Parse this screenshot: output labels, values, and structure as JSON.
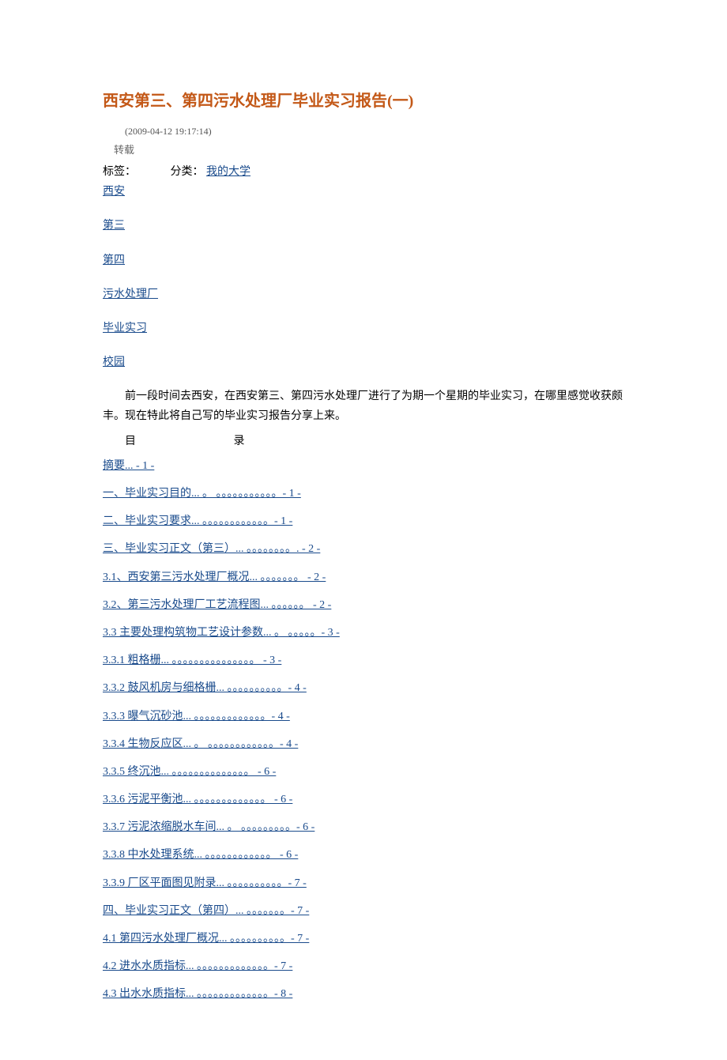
{
  "title": "西安第三、第四污水处理厂毕业实习报告(一)",
  "timestamp": "(2009-04-12 19:17:14)",
  "repost": "转载",
  "tag_label": "标签：",
  "category_label": "分类：",
  "category_link": "我的大学",
  "tags": [
    "西安",
    "第三",
    "第四",
    "污水处理厂",
    "毕业实习",
    "校园"
  ],
  "intro": "前一段时间去西安，在西安第三、第四污水处理厂进行了为期一个星期的毕业实习，在哪里感觉收获颇丰。现在特此将自己写的毕业实习报告分享上来。",
  "toc_label_1": "目",
  "toc_label_2": "录",
  "toc": [
    "摘要... - 1 -",
    "一、毕业实习目的... 。 。。。。。。。。。。。- 1 -",
    "二、毕业实习要求... 。。。。。。。。。。。。- 1 -",
    "三、毕业实习正文（第三）... 。。。。。。。。. - 2 -",
    "3.1、西安第三污水处理厂概况... 。。。。。。。 - 2 -",
    "3.2、第三污水处理厂工艺流程图... 。。。。。。  - 2 -",
    "3.3 主要处理构筑物工艺设计参数... 。 。。。。。- 3 -",
    "3.3.1 粗格栅... 。。。。。。。。。。。。。。。 - 3 -",
    "3.3.2 鼓风机房与细格栅... 。。。。。。。。。。- 4 -",
    "3.3.3 曝气沉砂池... 。。。。。。。。。。。。。- 4 -",
    "3.3.4 生物反应区... 。 。。。。。。。。。。。。- 4 -",
    "3.3.5 终沉池... 。。。。。。。。。。。。。。  - 6 -",
    "3.3.6 污泥平衡池... 。。。。。。。。。。。。。 - 6 -",
    "3.3.7 污泥浓缩脱水车间... 。 。。。。。。。。。- 6 -",
    "3.3.8 中水处理系统... 。。。。。。。。。。。。 - 6 -",
    "3.3.9 厂区平面图见附录... 。。。。。。。。。。- 7 -",
    "四、毕业实习正文（第四）... 。。。。。。。- 7 -",
    "4.1 第四污水处理厂概况... 。。。。。。。。。。- 7 -",
    "4.2 进水水质指标... 。。。。。。。。。。。。。- 7 -",
    "4.3 出水水质指标... 。。。。。。。。。。。。。- 8 -"
  ]
}
